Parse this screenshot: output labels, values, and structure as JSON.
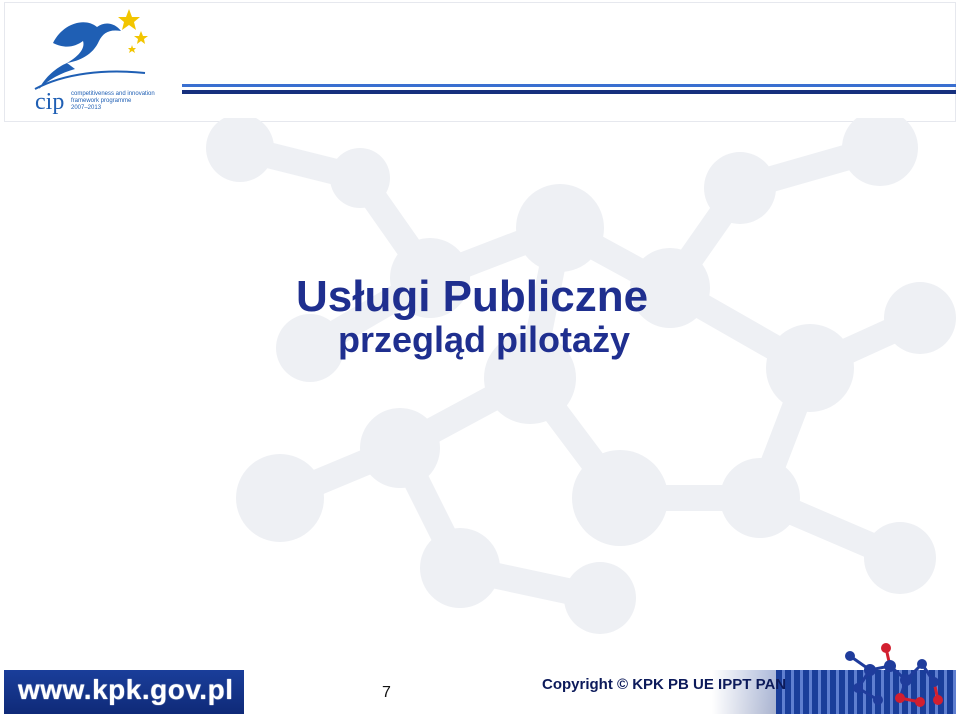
{
  "header": {
    "logo": {
      "text_main": "cip",
      "text_line1": "competitiveness and innovation",
      "text_line2": "framework programme",
      "text_line3": "2007–2013"
    },
    "accent_color": "#1f3c9c"
  },
  "slide": {
    "title": "Usługi Publiczne",
    "subtitle": "przegląd pilotaży",
    "title_color": "#1f2f8f"
  },
  "footer": {
    "site_url": "www.kpk.gov.pl",
    "page_number": "7",
    "copyright": "Copyright ©   KPK PB UE IPPT PAN",
    "bar_color": "#1a3e9a"
  }
}
